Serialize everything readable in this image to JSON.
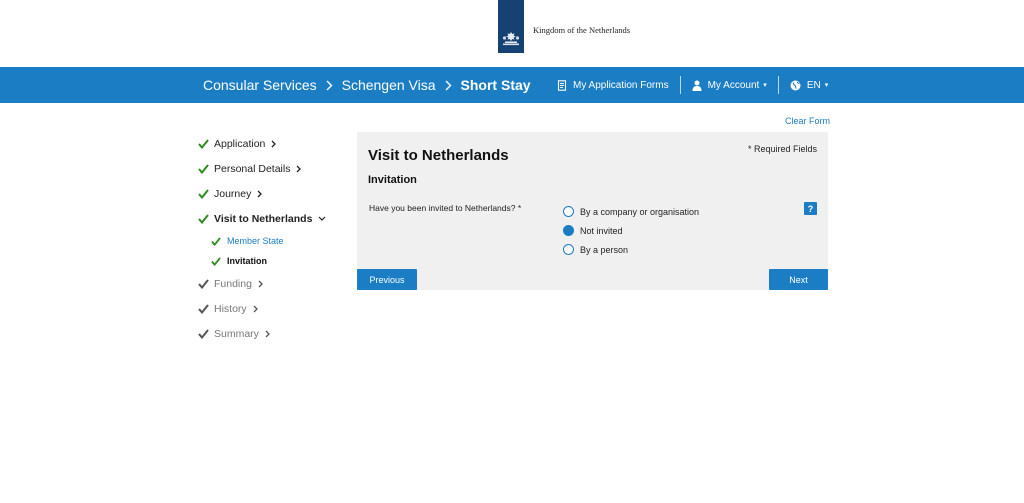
{
  "header": {
    "logo_text": "Kingdom of the Netherlands"
  },
  "nav": {
    "breadcrumbs": [
      "Consular Services",
      "Schengen Visa",
      "Short Stay"
    ],
    "my_forms": "My Application Forms",
    "my_account": "My Account",
    "language": "EN"
  },
  "steps": [
    {
      "label": "Application",
      "state": "done"
    },
    {
      "label": "Personal Details",
      "state": "done"
    },
    {
      "label": "Journey",
      "state": "done"
    },
    {
      "label": "Visit to Netherlands",
      "state": "active"
    },
    {
      "label": "Funding",
      "state": "pending"
    },
    {
      "label": "History",
      "state": "pending"
    },
    {
      "label": "Summary",
      "state": "pending"
    }
  ],
  "substeps": [
    {
      "label": "Member State"
    },
    {
      "label": "Invitation"
    }
  ],
  "form": {
    "clear_form": "Clear Form",
    "required_note": "* Required Fields",
    "title": "Visit to Netherlands",
    "section": "Invitation",
    "question": "Have you been invited to Netherlands? *",
    "options": [
      "By a company or organisation",
      "Not invited",
      "By a person"
    ],
    "selected_option": "Not invited",
    "help_label": "?",
    "previous": "Previous",
    "next": "Next"
  },
  "colors": {
    "brand_blue": "#1b7dc4",
    "logo_navy": "#154273",
    "check_green": "#2e8b1e"
  }
}
